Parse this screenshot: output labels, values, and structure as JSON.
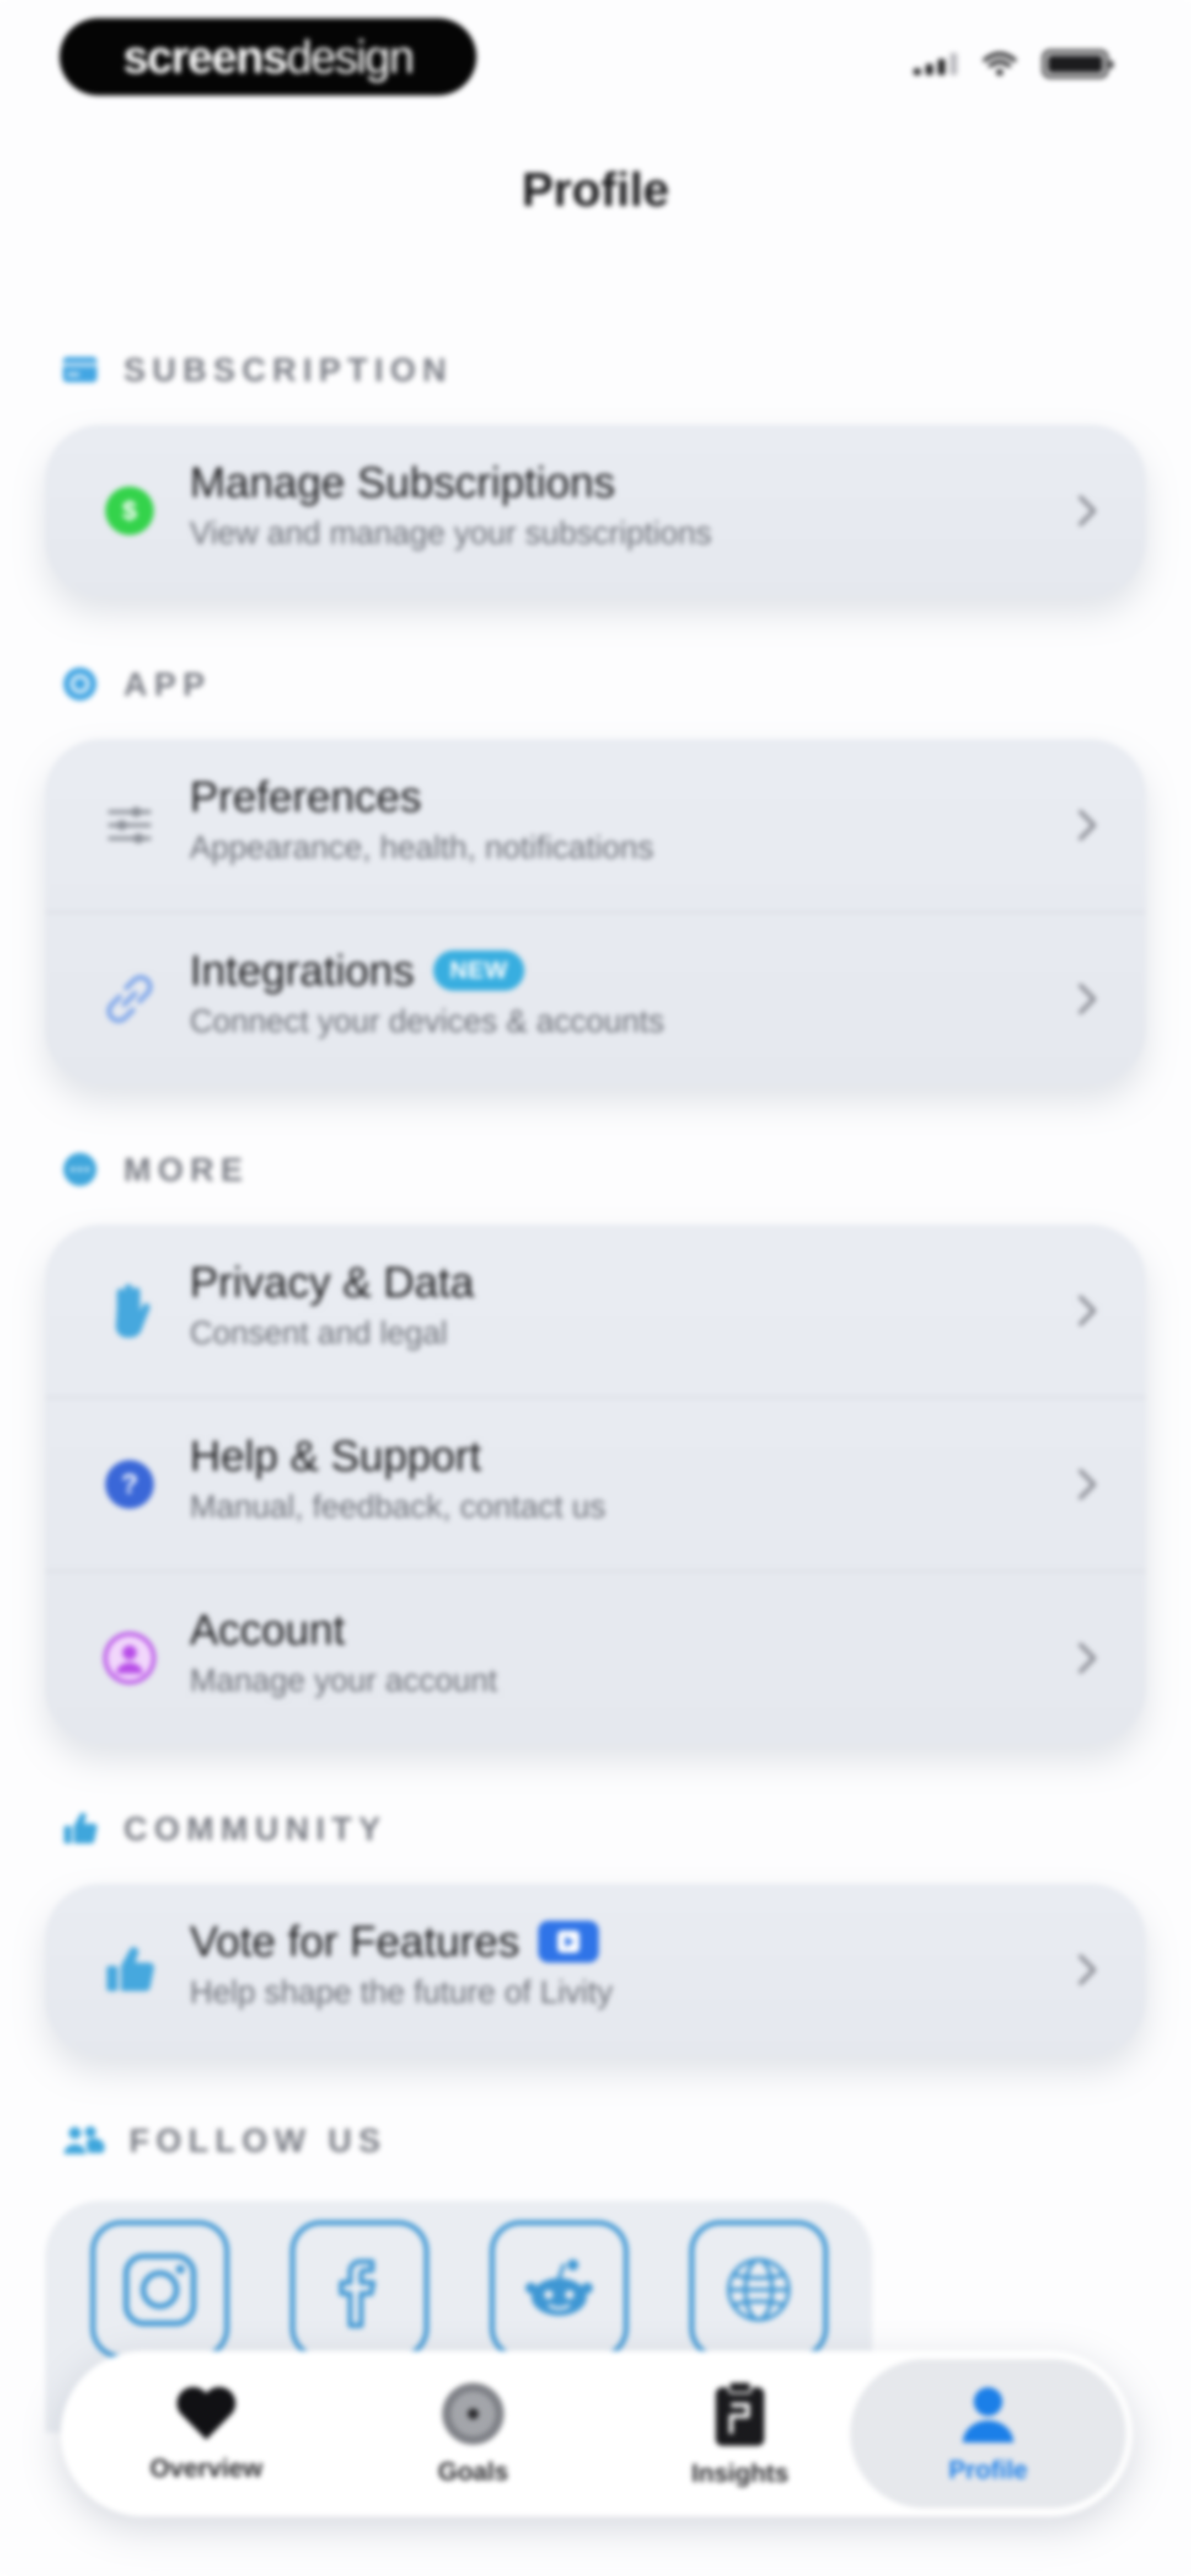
{
  "status_bar": {
    "brand_bold": "screens",
    "brand_light": "design",
    "icons": [
      "cellular-signal-icon",
      "wifi-icon",
      "battery-icon"
    ]
  },
  "header": {
    "title": "Profile"
  },
  "sections": {
    "subscription": {
      "label": "SUBSCRIPTION",
      "icon": "card-icon",
      "items": [
        {
          "title": "Manage Subscriptions",
          "subtitle": "View and manage your subscriptions",
          "icon": "dollar-icon"
        }
      ]
    },
    "app": {
      "label": "APP",
      "icon": "gear-icon",
      "items": [
        {
          "title": "Preferences",
          "subtitle": "Appearance, health, notifications",
          "icon": "sliders-icon"
        },
        {
          "title": "Integrations",
          "subtitle": "Connect your devices & accounts",
          "icon": "link-icon",
          "badge": "NEW"
        }
      ]
    },
    "more": {
      "label": "MORE",
      "icon": "ellipsis-circle-icon",
      "items": [
        {
          "title": "Privacy & Data",
          "subtitle": "Consent and legal",
          "icon": "hand-icon"
        },
        {
          "title": "Help & Support",
          "subtitle": "Manual, feedback, contact us",
          "icon": "question-icon"
        },
        {
          "title": "Account",
          "subtitle": "Manage your account",
          "icon": "person-circle-icon"
        }
      ]
    },
    "community": {
      "label": "COMMUNITY",
      "icon": "thumbs-up-icon",
      "items": [
        {
          "title": "Vote for Features",
          "subtitle": "Help shape the future of Livity",
          "icon": "thumbs-up-icon",
          "badge_icon": "play-icon"
        }
      ]
    },
    "follow_us": {
      "label": "FOLLOW US",
      "icon": "people-icon",
      "socials": [
        "instagram-icon",
        "facebook-icon",
        "reddit-icon",
        "globe-icon"
      ]
    }
  },
  "tab_bar": {
    "tabs": [
      {
        "label": "Overview",
        "icon": "heart-icon"
      },
      {
        "label": "Goals",
        "icon": "target-icon"
      },
      {
        "label": "Insights",
        "icon": "clipboard-icon"
      },
      {
        "label": "Profile",
        "icon": "person-icon",
        "active": true
      }
    ]
  },
  "colors": {
    "accent": "#1b7fe8",
    "social_border": "#3e97d4",
    "new_badge": "#38aee0",
    "dollar_green": "#34d34b",
    "help_blue": "#3a67d8",
    "account_purple": "#b84de8"
  }
}
